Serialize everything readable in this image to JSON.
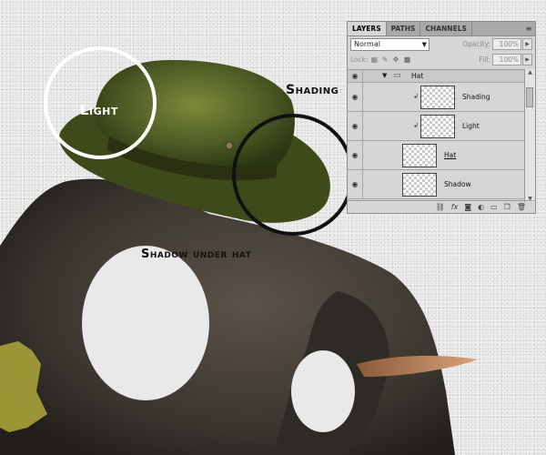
{
  "callouts": {
    "light": "Light",
    "shading": "Shading",
    "shadow_under_hat": "Shadow under hat"
  },
  "panel": {
    "tabs": [
      "LAYERS",
      "PATHS",
      "CHANNELS"
    ],
    "active_tab": "LAYERS",
    "menu_icon": "panel-menu-icon",
    "blend_mode": "Normal",
    "opacity_label": "Opacity:",
    "opacity_value": "100%",
    "lock_label": "Lock:",
    "fill_label": "Fill:",
    "fill_value": "100%",
    "layers": [
      {
        "name": "Hat",
        "type": "group"
      },
      {
        "name": "Shading",
        "type": "clipped"
      },
      {
        "name": "Light",
        "type": "clipped"
      },
      {
        "name": "Hat",
        "type": "layer"
      },
      {
        "name": "Shadow",
        "type": "layer"
      }
    ],
    "bottom_icons": [
      "link-icon",
      "fx-icon",
      "mask-icon",
      "adjustment-icon",
      "folder-icon",
      "new-layer-icon",
      "trash-icon"
    ]
  },
  "colors": {
    "hat": "#4c5a22",
    "elephant": "#3f3a34",
    "tusk": "#b57c55",
    "panel_bg": "#d6d6d6"
  }
}
